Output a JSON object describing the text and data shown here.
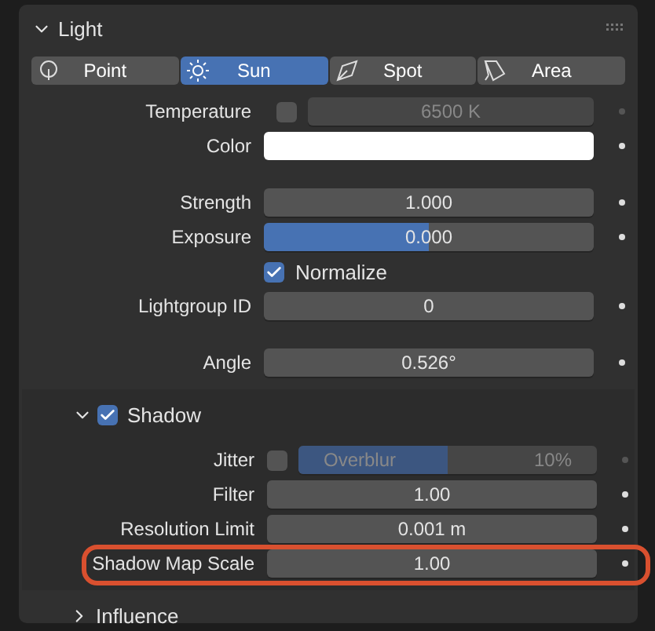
{
  "panel": {
    "title": "Light",
    "expanded": true
  },
  "light_types": [
    {
      "label": "Point",
      "kind": "point",
      "selected": false
    },
    {
      "label": "Sun",
      "kind": "sun",
      "selected": true
    },
    {
      "label": "Spot",
      "kind": "spot",
      "selected": false
    },
    {
      "label": "Area",
      "kind": "area",
      "selected": false
    }
  ],
  "groups": [
    [
      {
        "kind": "toggle_number",
        "label": "Temperature",
        "checked": false,
        "value": "6500 K",
        "disabled": true
      },
      {
        "kind": "color",
        "label": "Color",
        "color": "#ffffff"
      }
    ],
    [
      {
        "kind": "number",
        "label": "Strength",
        "value": "1.000"
      },
      {
        "kind": "slider",
        "label": "Exposure",
        "value": "0.000",
        "level": 0.5
      },
      {
        "kind": "checkbox",
        "label": "Normalize",
        "checked": true
      },
      {
        "kind": "number",
        "label": "Lightgroup ID",
        "value": "0"
      }
    ],
    [
      {
        "kind": "number",
        "label": "Angle",
        "value": "0.526°"
      }
    ]
  ],
  "shadow": {
    "title": "Shadow",
    "expanded": true,
    "checked": true,
    "rows": [
      {
        "kind": "toggle_slider",
        "label": "Jitter",
        "checked": false,
        "text": "Overblur",
        "value": "10%",
        "level": 0.5,
        "disabled": true
      },
      {
        "kind": "number",
        "label": "Filter",
        "value": "1.00"
      },
      {
        "kind": "number",
        "label": "Resolution Limit",
        "value": "0.001 m"
      },
      {
        "kind": "number",
        "label": "Shadow Map Scale",
        "value": "1.00",
        "highlighted": true
      }
    ]
  },
  "influence": {
    "title": "Influence",
    "expanded": false
  }
}
